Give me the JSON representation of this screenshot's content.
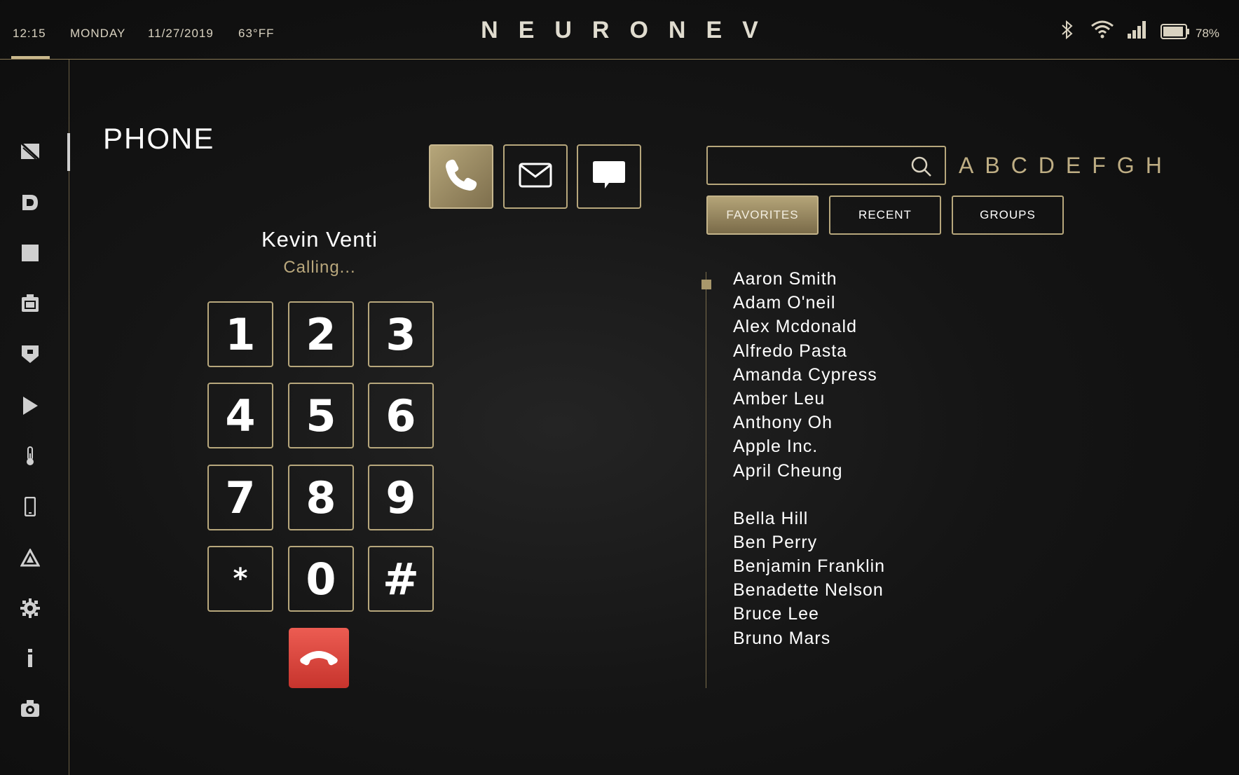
{
  "status_bar": {
    "time": "12:15",
    "day": "MONDAY",
    "date": "11/27/2019",
    "temperature": "63°FF",
    "brand": "NEURONEV",
    "battery_percent": "78%"
  },
  "sidebar": {
    "icons": [
      "lights-off-icon",
      "drive-icon",
      "square-icon",
      "seat-icon",
      "shield-icon",
      "play-icon",
      "thermometer-icon",
      "phone-device-icon",
      "warning-icon",
      "gear-icon",
      "info-icon",
      "camera-icon"
    ],
    "active_item": "phone-device-icon"
  },
  "page": {
    "title": "PHONE"
  },
  "modes": [
    {
      "name": "phone-mode-button",
      "icon": "phone-icon",
      "active": true
    },
    {
      "name": "email-mode-button",
      "icon": "envelope-icon",
      "active": false
    },
    {
      "name": "message-mode-button",
      "icon": "chat-bubble-icon",
      "active": false
    }
  ],
  "call": {
    "caller_name": "Kevin Venti",
    "status": "Calling..."
  },
  "keypad": {
    "keys": [
      "1",
      "2",
      "3",
      "4",
      "5",
      "6",
      "7",
      "8",
      "9",
      "*",
      "0",
      "#"
    ]
  },
  "search": {
    "placeholder": "",
    "value": ""
  },
  "alphabet": [
    "A",
    "B",
    "C",
    "D",
    "E",
    "F",
    "G",
    "H"
  ],
  "tabs": [
    {
      "label": "FAVORITES",
      "active": true
    },
    {
      "label": "RECENT",
      "active": false
    },
    {
      "label": "GROUPS",
      "active": false
    }
  ],
  "contacts": {
    "group_a": [
      "Aaron Smith",
      "Adam O'neil",
      "Alex Mcdonald",
      "Alfredo Pasta",
      "Amanda Cypress",
      "Amber Leu",
      "Anthony Oh",
      "Apple Inc.",
      "April Cheung"
    ],
    "group_b": [
      "Bella Hill",
      "Ben Perry",
      "Benjamin Franklin",
      "Benadette Nelson",
      "Bruce Lee",
      "Bruno Mars"
    ]
  },
  "colors": {
    "accent_gold": "#b7a77c",
    "end_call_red": "#d9443b",
    "background": "#151515"
  }
}
